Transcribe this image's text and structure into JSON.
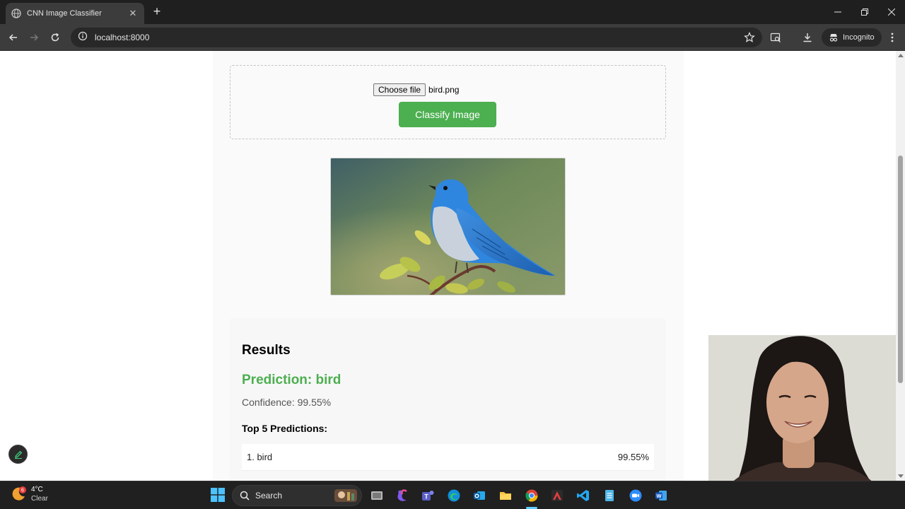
{
  "browser": {
    "tab_title": "CNN Image Classifier",
    "url": "localhost:8000",
    "incognito_label": "Incognito"
  },
  "page": {
    "choose_file_label": "Choose file",
    "file_name": "bird.png",
    "classify_label": "Classify Image",
    "results_title": "Results",
    "prediction": "Prediction: bird",
    "confidence": "Confidence: 99.55%",
    "top5_title": "Top 5 Predictions:",
    "top_predictions": [
      {
        "label": "1. bird",
        "value": "99.55%"
      }
    ]
  },
  "taskbar": {
    "weather_temp": "4°C",
    "weather_condition": "Clear",
    "weather_badge": "6",
    "search_label": "Search"
  },
  "colors": {
    "accent_green": "#4caf50",
    "chrome_dark": "#3c3c3c"
  }
}
